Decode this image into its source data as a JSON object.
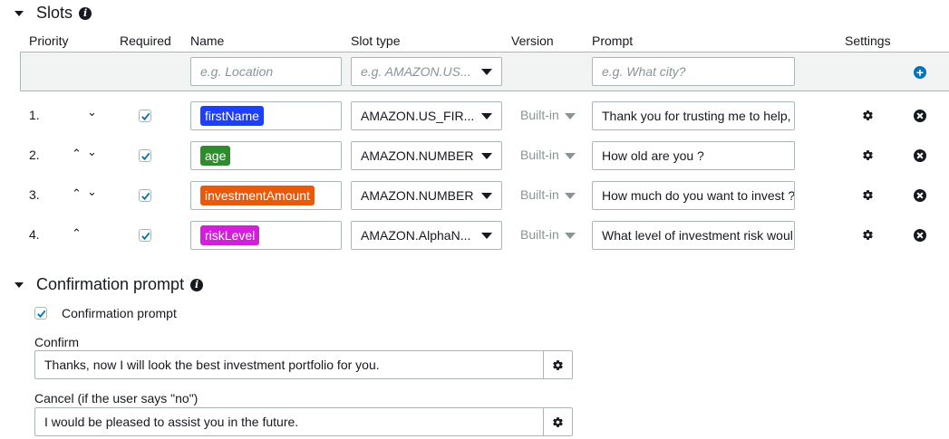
{
  "slots_section": {
    "title": "Slots"
  },
  "columns": {
    "priority": "Priority",
    "required": "Required",
    "name": "Name",
    "slot_type": "Slot type",
    "version": "Version",
    "prompt": "Prompt",
    "settings": "Settings"
  },
  "new_slot": {
    "name_placeholder": "e.g. Location",
    "slot_type_placeholder": "e.g. AMAZON.US...",
    "prompt_placeholder": "e.g. What city?"
  },
  "slots": [
    {
      "priority": "1.",
      "up": false,
      "down": true,
      "required": true,
      "name": "firstName",
      "chip_color": "#1f3fff",
      "slot_type": "AMAZON.US_FIR...",
      "version": "Built-in",
      "prompt": "Thank you for trusting me to help,"
    },
    {
      "priority": "2.",
      "up": true,
      "down": true,
      "required": true,
      "name": "age",
      "chip_color": "#2e8b2e",
      "slot_type": "AMAZON.NUMBER",
      "version": "Built-in",
      "prompt": "How old are you ?"
    },
    {
      "priority": "3.",
      "up": true,
      "down": true,
      "required": true,
      "name": "investmentAmount",
      "chip_color": "#e8590c",
      "slot_type": "AMAZON.NUMBER",
      "version": "Built-in",
      "prompt": "How much do you want to invest ?"
    },
    {
      "priority": "4.",
      "up": true,
      "down": false,
      "required": true,
      "name": "riskLevel",
      "chip_color": "#d21fd9",
      "slot_type": "AMAZON.AlphaN...",
      "version": "Built-in",
      "prompt": "What level of investment risk woul"
    }
  ],
  "confirmation_section": {
    "title": "Confirmation prompt",
    "checkbox_label": "Confirmation prompt",
    "checked": true,
    "confirm_label": "Confirm",
    "confirm_value": "Thanks, now I will look the best investment portfolio for you.",
    "cancel_label": "Cancel (if the user says \"no\")",
    "cancel_value": "I would be pleased to assist you in the future."
  },
  "colors": {
    "accent": "#0073bb",
    "border": "#aab7b8",
    "muted": "#879596"
  }
}
